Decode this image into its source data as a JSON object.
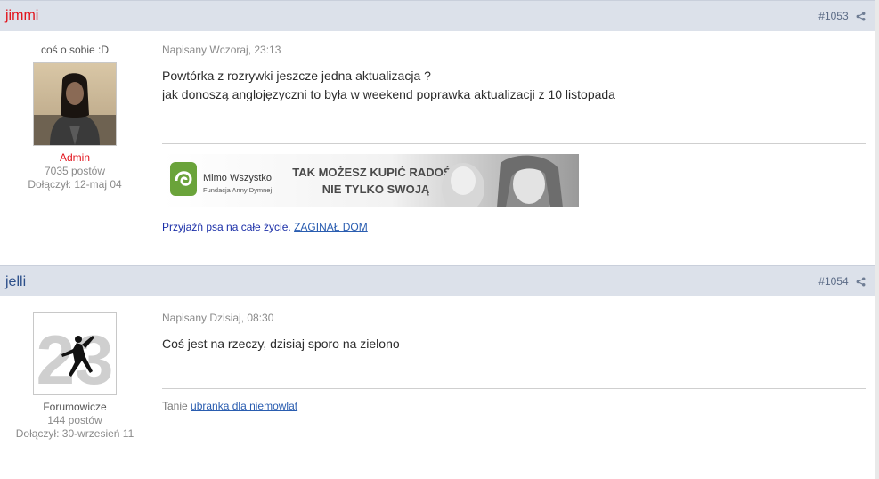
{
  "posts": [
    {
      "author": "jimmi",
      "post_number": "#1053",
      "user_title": "coś o sobie :D",
      "rank": "Admin",
      "post_count": "7035 postów",
      "joined": "Dołączył: 12-maj 04",
      "posted": "Napisany Wczoraj, 23:13",
      "message_lines": [
        "Powtórka z rozrywki jeszcze jedna aktualizacja ?",
        "jak donoszą anglojęzyczni to była w weekend poprawka aktualizacji z 10 listopada"
      ],
      "banner": {
        "logo_name": "Mimo Wszystko",
        "logo_sub": "Fundacja Anny Dymnej",
        "slogan_line1": "TAK MOŻESZ KUPIĆ RADOŚĆ",
        "slogan_line2": "NIE TYLKO SWOJĄ"
      },
      "signature_text": "Przyjaźń psa na całe życie.",
      "signature_link": "ZAGINAŁ DOM"
    },
    {
      "author": "jelli",
      "post_number": "#1054",
      "rank": "Forumowicze",
      "post_count": "144 postów",
      "joined": "Dołączył: 30-wrzesień 11",
      "posted": "Napisany Dzisiaj, 08:30",
      "message_lines": [
        "Coś jest na rzeczy, dzisiaj sporo na zielono"
      ],
      "signature_text": "Tanie",
      "signature_link": "ubranka dla niemowlat"
    }
  ],
  "colors": {
    "header_bg": "#dce1ea",
    "admin": "#e2131c",
    "author_default": "#2c4f8a",
    "link": "#2a5db0"
  },
  "icons": {
    "share": "share-icon"
  }
}
